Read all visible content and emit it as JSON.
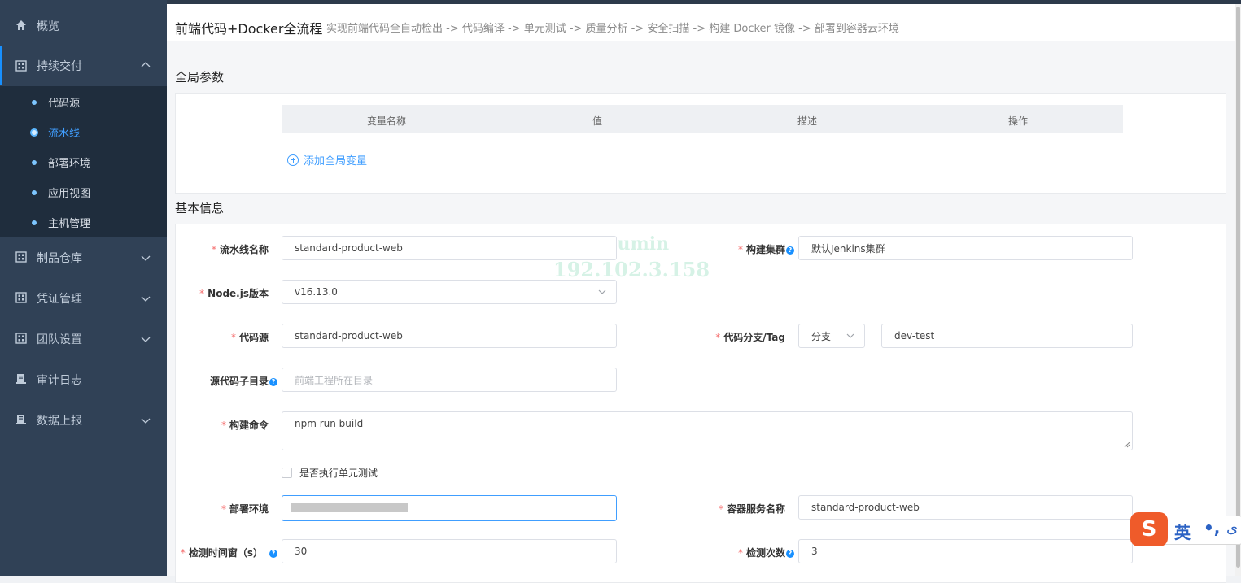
{
  "sidebar": {
    "items": [
      {
        "label": "概览",
        "icon": "home-icon"
      },
      {
        "label": "持续交付",
        "icon": "grid-icon",
        "expanded": true
      },
      {
        "label": "制品仓库",
        "icon": "grid-icon"
      },
      {
        "label": "凭证管理",
        "icon": "grid-icon"
      },
      {
        "label": "团队设置",
        "icon": "grid-icon"
      },
      {
        "label": "审计日志",
        "icon": "document-icon"
      },
      {
        "label": "数据上报",
        "icon": "document-icon"
      }
    ],
    "subitems": [
      {
        "label": "代码源"
      },
      {
        "label": "流水线",
        "current": true
      },
      {
        "label": "部署环境"
      },
      {
        "label": "应用视图"
      },
      {
        "label": "主机管理"
      }
    ]
  },
  "header": {
    "title": "前端代码+Docker全流程",
    "description": "实现前端代码全自动检出 -> 代码编译 -> 单元测试 -> 质量分析 -> 安全扫描 -> 构建 Docker 镜像 -> 部署到容器云环境"
  },
  "global_params": {
    "title": "全局参数",
    "columns": [
      "变量名称",
      "值",
      "描述",
      "操作"
    ],
    "add_label": "添加全局变量"
  },
  "basic_info": {
    "title": "基本信息",
    "fields": {
      "pipeline_name": {
        "label": "流水线名称",
        "value": "standard-product-web"
      },
      "build_cluster": {
        "label": "构建集群",
        "value": "默认Jenkins集群"
      },
      "nodejs_version": {
        "label": "Node.js版本",
        "value": "v16.13.0"
      },
      "code_source": {
        "label": "代码源",
        "value": "standard-product-web"
      },
      "branch_tag": {
        "label": "代码分支/Tag",
        "type_value": "分支",
        "value": "dev-test"
      },
      "source_subdir": {
        "label": "源代码子目录",
        "placeholder": "前端工程所在目录"
      },
      "build_command": {
        "label": "构建命令",
        "value": "npm run build"
      },
      "unit_test": {
        "label": "是否执行单元测试",
        "checked": false
      },
      "deploy_env": {
        "label": "部署环境"
      },
      "container_service": {
        "label": "容器服务名称",
        "value": "standard-product-web"
      },
      "check_interval": {
        "label": "检测时间窗（s）",
        "value": "30"
      },
      "check_count": {
        "label": "检测次数",
        "value": "3"
      }
    }
  },
  "watermark": {
    "line1": "zhumin",
    "line2": "192.102.3.158"
  },
  "ime": {
    "logo": "S",
    "mode": "英",
    "punct": "•,",
    "extra": "ی"
  },
  "colors": {
    "sidebar_bg": "#304156",
    "submenu_bg": "#1f2d3d",
    "accent": "#409eff",
    "required": "#f56c6c"
  }
}
